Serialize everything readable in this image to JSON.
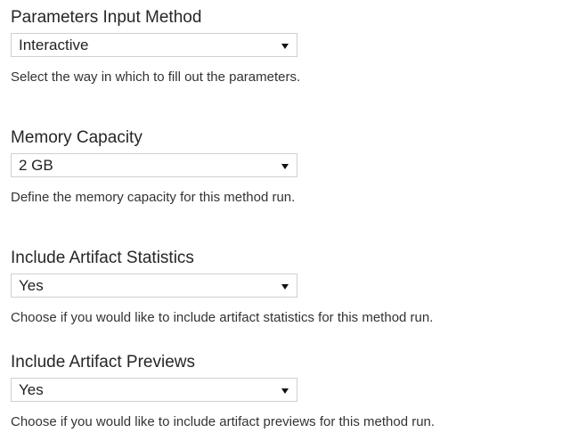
{
  "fields": [
    {
      "label": "Parameters Input Method",
      "value": "Interactive",
      "help": "Select the way in which to fill out the parameters."
    },
    {
      "label": "Memory Capacity",
      "value": "2 GB",
      "help": "Define the memory capacity for this method run."
    },
    {
      "label": "Include Artifact Statistics",
      "value": "Yes",
      "help": "Choose if you would like to include artifact statistics for this method run."
    },
    {
      "label": "Include Artifact Previews",
      "value": "Yes",
      "help": "Choose if you would like to include artifact previews for this method run."
    }
  ],
  "icons": {
    "dropdown": "caret-down-icon"
  }
}
